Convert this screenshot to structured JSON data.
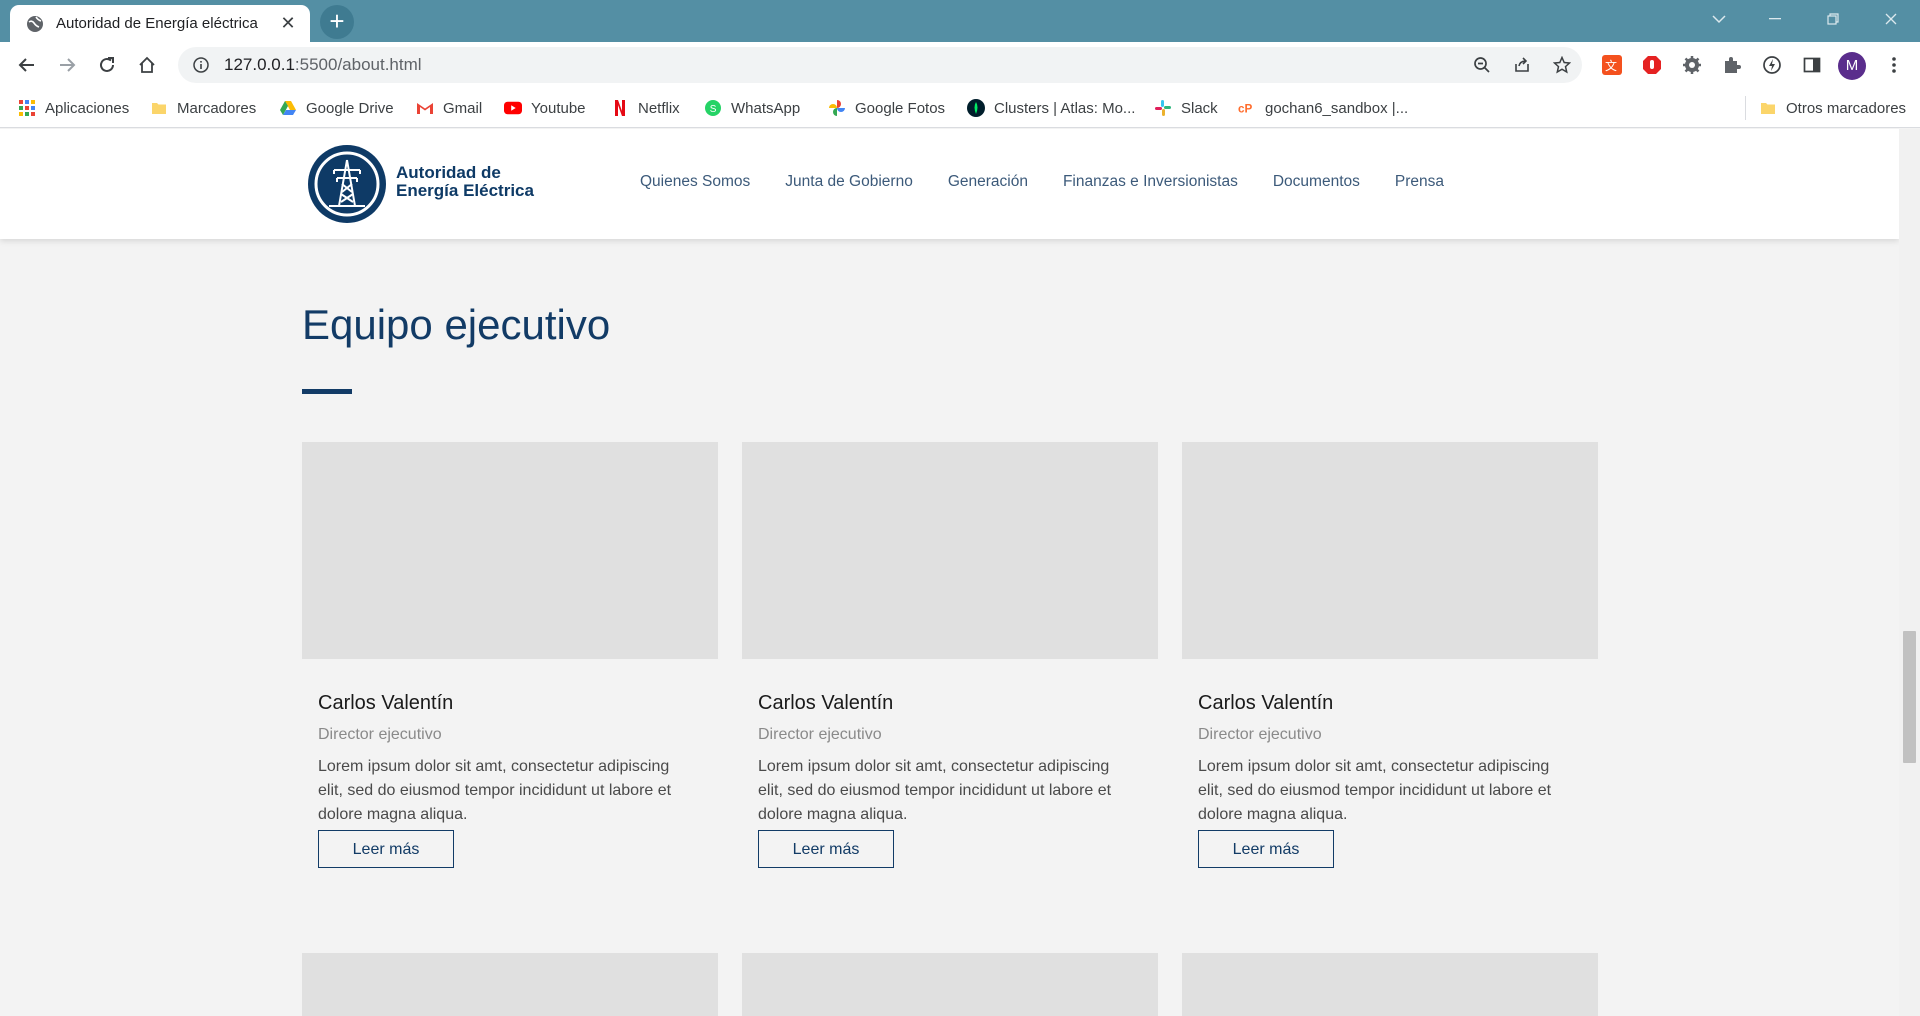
{
  "browser": {
    "tab_title": "Autoridad de Energía eléctrica",
    "tab_close": "✕",
    "new_tab": "+",
    "url_host": "127.0.0.1",
    "url_path": ":5500/about.html",
    "profile_initial": "M"
  },
  "bookmarks": [
    {
      "label": "Aplicaciones",
      "icon": "apps-grid-icon"
    },
    {
      "label": "Marcadores",
      "icon": "folder-icon"
    },
    {
      "label": "Google Drive",
      "icon": "google-drive-icon"
    },
    {
      "label": "Gmail",
      "icon": "gmail-icon"
    },
    {
      "label": "Youtube",
      "icon": "youtube-icon"
    },
    {
      "label": "Netflix",
      "icon": "netflix-icon"
    },
    {
      "label": "WhatsApp",
      "icon": "whatsapp-icon"
    },
    {
      "label": "Google Fotos",
      "icon": "google-photos-icon"
    },
    {
      "label": "Clusters | Atlas: Mo...",
      "icon": "mongodb-icon"
    },
    {
      "label": "Slack",
      "icon": "slack-icon"
    },
    {
      "label": "gochan6_sandbox |...",
      "icon": "cpanel-icon"
    },
    {
      "label": "Otros marcadores",
      "icon": "folder-icon"
    }
  ],
  "site": {
    "brand_line1": "Autoridad de",
    "brand_line2": "Energía Eléctrica",
    "nav": [
      "Quienes Somos",
      "Junta de Gobierno",
      "Generación",
      "Finanzas e Inversionistas",
      "Documentos",
      "Prensa"
    ]
  },
  "section": {
    "title": "Equipo ejecutivo"
  },
  "cards": [
    {
      "name": "Carlos Valentín",
      "role": "Director ejecutivo",
      "desc": "Lorem ipsum dolor sit amt, consectetur adipiscing elit, sed do eiusmod tempor incididunt ut labore et dolore magna aliqua.",
      "button": "Leer más"
    },
    {
      "name": "Carlos Valentín",
      "role": "Director ejecutivo",
      "desc": "Lorem ipsum dolor sit amt, consectetur adipiscing elit, sed do eiusmod tempor incididunt ut labore et dolore magna aliqua.",
      "button": "Leer más"
    },
    {
      "name": "Carlos Valentín",
      "role": "Director ejecutivo",
      "desc": "Lorem ipsum dolor sit amt, consectetur adipiscing elit, sed do eiusmod tempor incididunt ut labore et dolore magna aliqua.",
      "button": "Leer más"
    }
  ],
  "colors": {
    "browser_frame": "#548fa4",
    "brand_navy": "#123b66",
    "page_bg": "#f3f3f3",
    "photo_placeholder": "#e0e0e0"
  }
}
